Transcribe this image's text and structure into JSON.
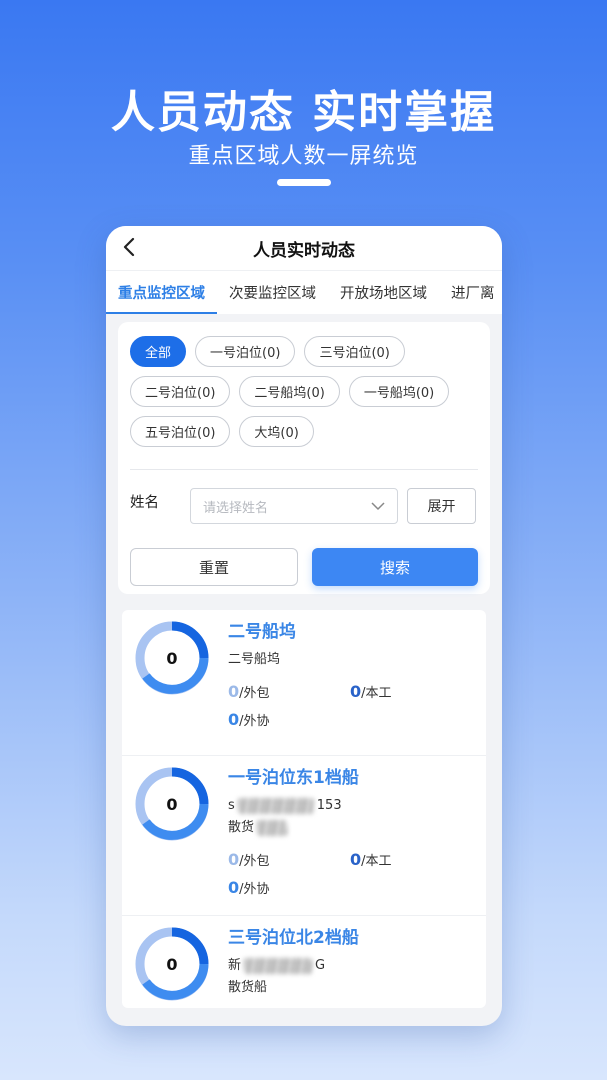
{
  "hero": {
    "title": "人员动态 实时掌握",
    "subtitle": "重点区域人数一屏统览"
  },
  "nav": {
    "title": "人员实时动态",
    "back_icon": "chevron-left-icon"
  },
  "tabs": [
    {
      "label": "重点监控区域",
      "active": true
    },
    {
      "label": "次要监控区域",
      "active": false
    },
    {
      "label": "开放场地区域",
      "active": false
    },
    {
      "label": "进厂离",
      "active": false
    }
  ],
  "filter": {
    "chips": [
      {
        "label": "全部",
        "active": true
      },
      {
        "label": "一号泊位(0)",
        "active": false
      },
      {
        "label": "三号泊位(0)",
        "active": false
      },
      {
        "label": "二号泊位(0)",
        "active": false
      },
      {
        "label": "二号船坞(0)",
        "active": false
      },
      {
        "label": "一号船坞(0)",
        "active": false
      },
      {
        "label": "五号泊位(0)",
        "active": false
      },
      {
        "label": "大坞(0)",
        "active": false
      }
    ],
    "name_label": "姓名",
    "name_placeholder": "请选择姓名",
    "expand_label": "展开",
    "reset_label": "重置",
    "search_label": "搜索"
  },
  "list": [
    {
      "count": "0",
      "title": "二号船坞",
      "lines": [
        "二号船坞"
      ],
      "stats": [
        {
          "value": "0",
          "label": "/外包"
        },
        {
          "value": "0",
          "label": "/本工"
        },
        {
          "value": "0",
          "label": "/外协"
        }
      ]
    },
    {
      "count": "0",
      "title": "一号泊位东1档船",
      "lines": [
        "153",
        "散货"
      ],
      "line_prefixes": [
        "s",
        ""
      ],
      "stats": [
        {
          "value": "0",
          "label": "/外包"
        },
        {
          "value": "0",
          "label": "/本工"
        },
        {
          "value": "0",
          "label": "/外协"
        }
      ]
    },
    {
      "count": "0",
      "title": "三号泊位北2档船",
      "lines": [
        "G",
        "散货船"
      ],
      "line_prefixes": [
        "新",
        ""
      ],
      "stats": []
    }
  ],
  "colors": {
    "accent": "#1d6ee8",
    "tab_active": "#2d7fe6",
    "ring_dark": "#1565e0",
    "ring_light": "#a9c4f2",
    "ring_mid": "#3e8cf0"
  }
}
